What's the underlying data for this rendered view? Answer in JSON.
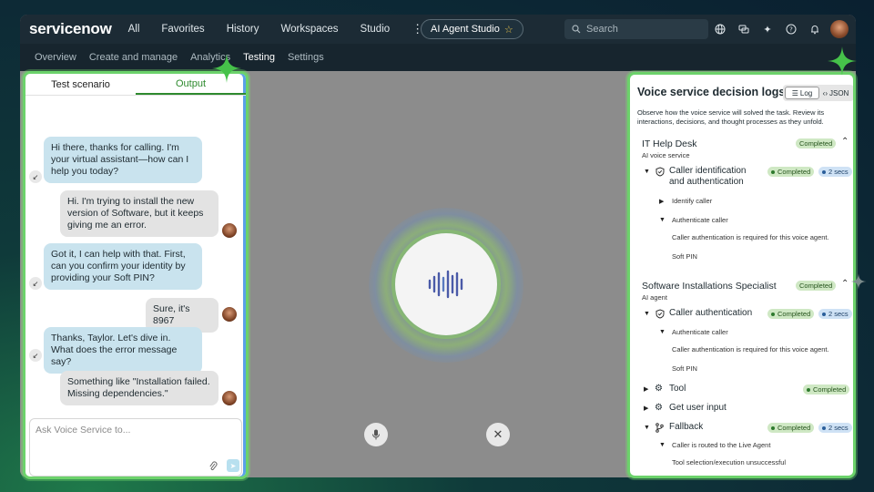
{
  "topbar": {
    "logo": "servicenow",
    "nav": [
      "All",
      "Favorites",
      "History",
      "Workspaces",
      "Studio"
    ],
    "kebab": "⋮",
    "app_pill": "AI Agent Studio",
    "search_placeholder": "Search"
  },
  "subnav": {
    "tabs": [
      "Overview",
      "Create and manage",
      "Analytics",
      "Testing",
      "Settings"
    ],
    "active": "Testing"
  },
  "chat": {
    "tabs": [
      "Test scenario",
      "Output"
    ],
    "active_tab": "Output",
    "messages": [
      {
        "role": "bot",
        "text": "Hi there, thanks for calling. I'm your virtual assistant—how can I help you today?"
      },
      {
        "role": "user",
        "text": "Hi. I'm trying to install the new version of Software, but it keeps giving me an error."
      },
      {
        "role": "bot",
        "text": "Got it, I can help with that. First, can you confirm your identity by providing your Soft PIN?"
      },
      {
        "role": "user",
        "text": "Sure, it's 8967"
      },
      {
        "role": "bot",
        "text": "Thanks, Taylor. Let's dive in. What does the error message say?"
      },
      {
        "role": "user",
        "text": "Something like \"Installation failed. Missing dependencies.\""
      }
    ],
    "input_placeholder": "Ask Voice Service to..."
  },
  "log": {
    "title": "Voice service decision logs",
    "toggle": [
      "Log",
      "JSON"
    ],
    "description": "Observe how the voice service will solved the task. Review its interactions, decisions, and thought processes as they unfold.",
    "sections": [
      {
        "name": "IT Help Desk",
        "subtitle": "AI voice service",
        "status": "Completed",
        "steps": [
          {
            "name": "Caller identification and authentication",
            "status": "Completed",
            "time": "2 secs",
            "children": [
              "Identify caller",
              "Authenticate caller",
              "Caller authentication is required for this voice agent.",
              "Soft PIN"
            ]
          }
        ]
      },
      {
        "name": "Software Installations Specialist",
        "subtitle": "AI agent",
        "status": "Completed",
        "steps": [
          {
            "name": "Caller authentication",
            "status": "Completed",
            "time": "2 secs",
            "children": [
              "Authenticate caller",
              "Caller authentication is required for this voice agent.",
              "Soft PIN"
            ]
          },
          {
            "name": "Tool",
            "status": "Completed"
          },
          {
            "name": "Get user input"
          },
          {
            "name": "Fallback",
            "status": "Completed",
            "time": "2 secs",
            "children": [
              "Caller is routed to the Live Agent",
              "Tool selection/execution unsuccessful"
            ]
          }
        ]
      }
    ]
  },
  "colors": {
    "accent_green": "#6cd26b",
    "bot_bubble": "#c9e3ee",
    "user_bubble": "#e3e3e3",
    "badge_green": "#cfe8c4",
    "badge_blue": "#cfe2f5"
  }
}
